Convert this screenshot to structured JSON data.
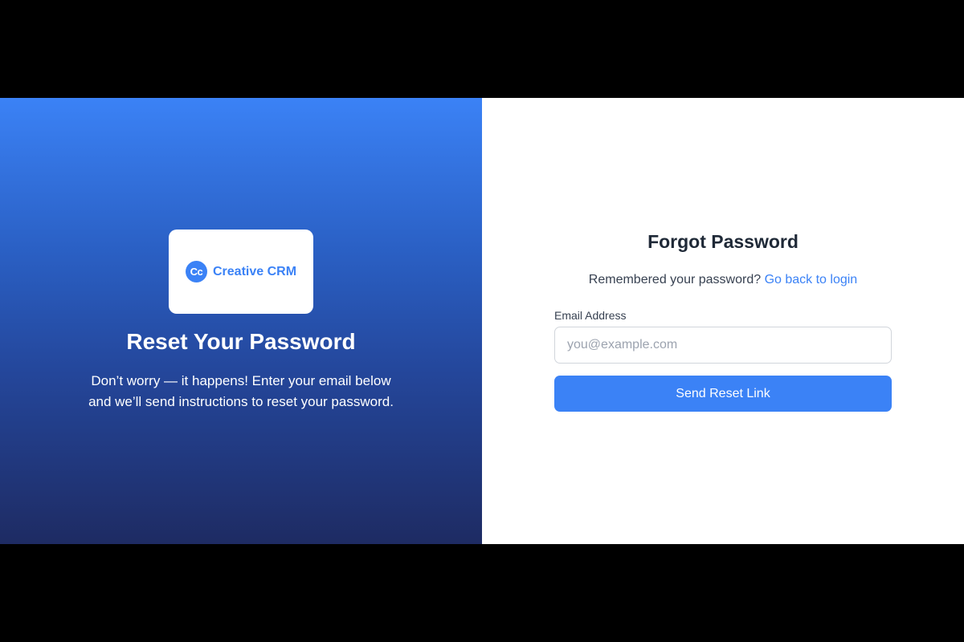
{
  "brand": {
    "logo_mark": "Cc",
    "logo_text": "Creative CRM",
    "accent_color": "#3b82f6"
  },
  "hero": {
    "title": "Reset Your Password",
    "description_line1": "Don’t worry — it happens! Enter your email below",
    "description_line2": "and we’ll send instructions to reset your password.",
    "gradient_top": "#3b82f6",
    "gradient_bottom": "#1e2b63"
  },
  "form": {
    "title": "Forgot Password",
    "subtitle_text": "Remembered your password?",
    "back_link_label": "Go back to login",
    "email_label": "Email Address",
    "email_placeholder": "you@example.com",
    "email_value": "",
    "submit_label": "Send Reset Link"
  }
}
